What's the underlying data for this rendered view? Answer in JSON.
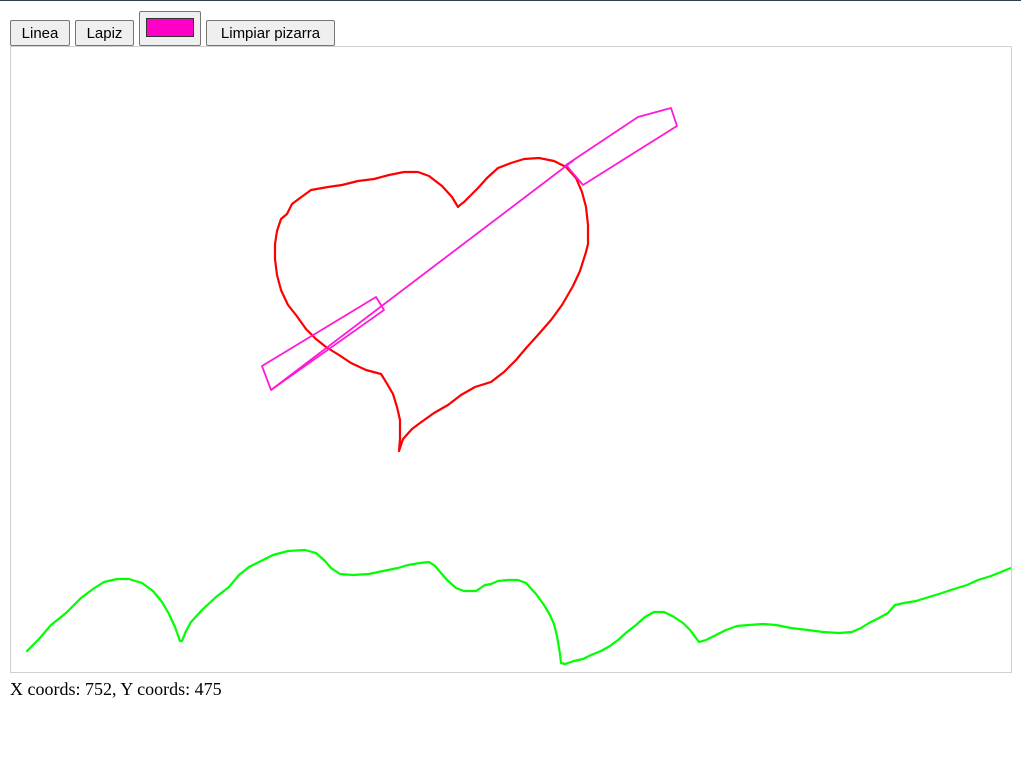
{
  "toolbar": {
    "line_label": "Linea",
    "pencil_label": "Lapiz",
    "clear_label": "Limpiar pizarra",
    "selected_color": "#ff00c8"
  },
  "canvas": {
    "strokes": [
      {
        "tool": "pencil",
        "color": "#ff0000",
        "shape": "heart"
      },
      {
        "tool": "line",
        "color": "#ff19d6",
        "shape": "arrow"
      },
      {
        "tool": "pencil",
        "color": "#00ff00",
        "shape": "wave"
      }
    ]
  },
  "status": {
    "prefix_x": "X coords: ",
    "x_value": "752",
    "separator": ", ",
    "prefix_y": "Y coords: ",
    "y_value": "475"
  }
}
